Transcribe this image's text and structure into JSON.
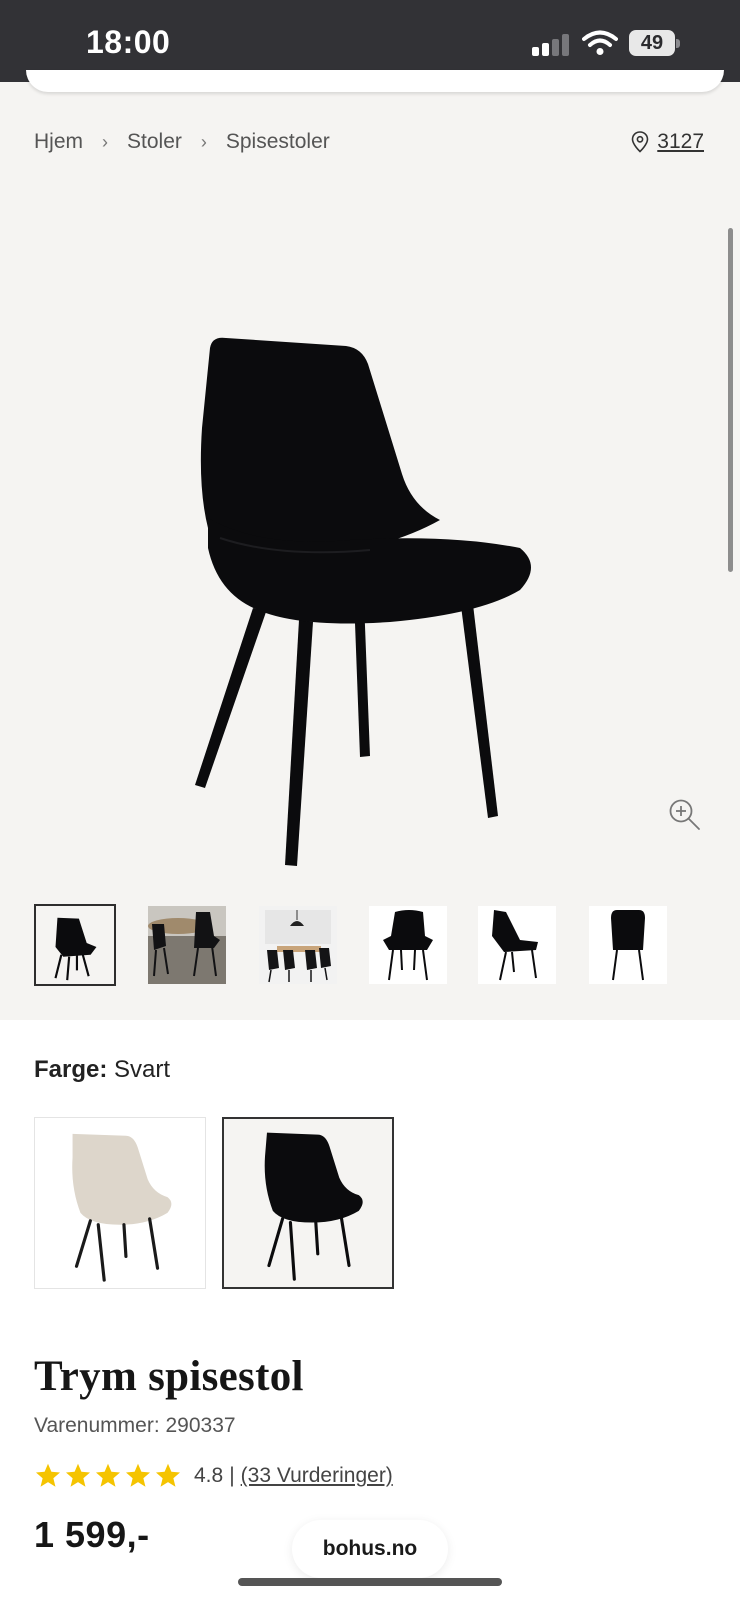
{
  "status_bar": {
    "time": "18:00",
    "battery": "49",
    "icons": [
      "cellular-signal-icon",
      "wifi-icon",
      "battery-icon"
    ]
  },
  "breadcrumb": {
    "items": [
      "Hjem",
      "Stoler",
      "Spisestoler"
    ],
    "separator": "›"
  },
  "store": {
    "icon": "location-pin-icon",
    "number": "3127"
  },
  "gallery": {
    "zoom_icon": "zoom-in-icon",
    "thumbnail_count": 6,
    "active_thumbnail": 0
  },
  "color": {
    "label": "Farge:",
    "value": "Svart",
    "swatches": [
      "beige",
      "black"
    ],
    "selected_index": 1
  },
  "product": {
    "title": "Trym spisestol",
    "sku": "Varenummer: 290337",
    "rating_value": 4.8,
    "rating_text": "4.8",
    "rating_separator": "|",
    "reviews_text": "(33 Vurderinger)",
    "price": "1 599,-"
  },
  "browser": {
    "url": "bohus.no"
  },
  "colors": {
    "star": "#f5c400",
    "status_bar": "#323236",
    "gallery_bg": "#f5f4f2"
  }
}
